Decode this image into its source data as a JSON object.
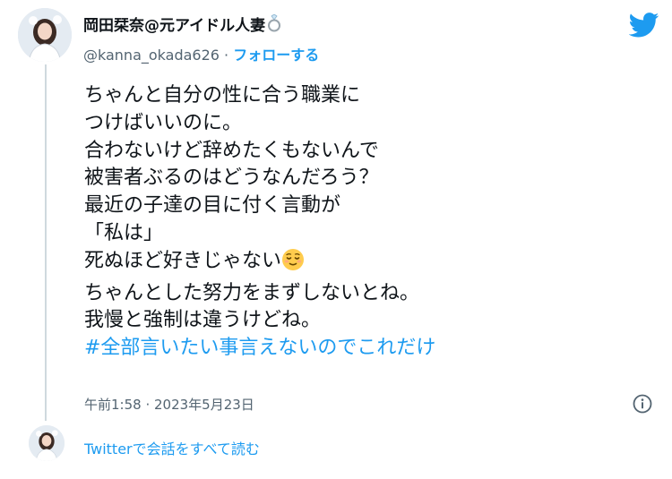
{
  "author": {
    "display_name": "岡田栞奈@元アイドル人妻",
    "name_emoji": "ring-icon",
    "handle": "@kanna_okada626",
    "separator": "·",
    "follow_label": "フォローする"
  },
  "tweet": {
    "lines": [
      "ちゃんと自分の性に合う職業に",
      "つけばいいのに。",
      "合わないけど辞めたくもないんで",
      "被害者ぶるのはどうなんだろう？",
      "最近の子達の目に付く言動が",
      "「私は」",
      "死ぬほど好きじゃない",
      "ちゃんとした努力をまずしないとね。",
      "我慢と強制は違うけどね。"
    ],
    "emoji_after_line_7": "relieved-face-emoji",
    "hashtag": "#全部言いたい事言えないのでこれだけ"
  },
  "meta": {
    "timestamp": "午前1:58 · 2023年5月23日"
  },
  "footer": {
    "read_conversation": "Twitterで会話をすべて読む"
  },
  "colors": {
    "accent": "#1d9bf0",
    "text": "#0f1419",
    "muted": "#536471",
    "thread_line": "#cfd9de"
  }
}
